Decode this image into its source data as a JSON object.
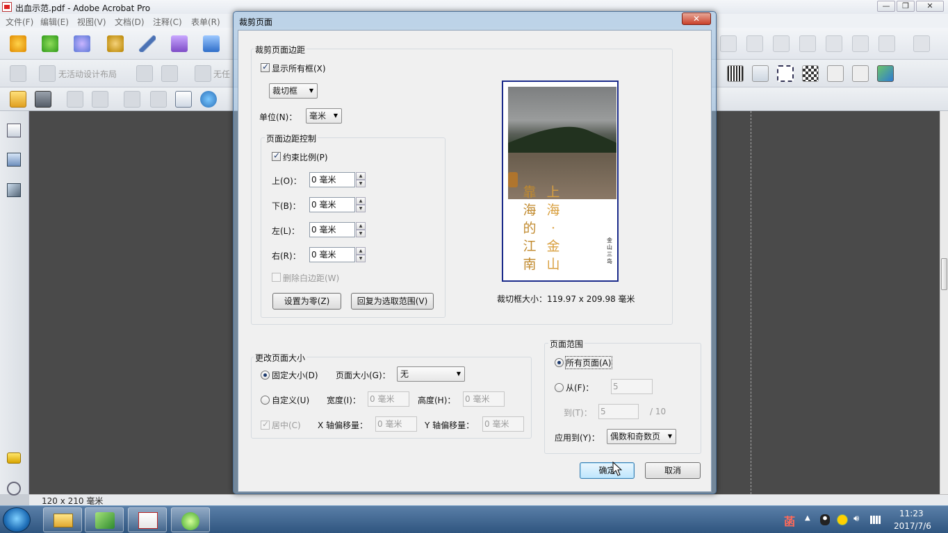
{
  "app": {
    "title": "出血示范.pdf - Adobe Acrobat Pro",
    "menus": [
      "文件(F)",
      "编辑(E)",
      "视图(V)",
      "文档(D)",
      "注释(C)",
      "表单(R)"
    ],
    "toolbar2": {
      "layout_label": "无活动设计布局",
      "task_label": "无任"
    },
    "status_page_size": "120 x 210 毫米",
    "window_controls": [
      "—",
      "❐",
      "✕"
    ]
  },
  "taskbar": {
    "time": "11:23",
    "date": "2017/7/6",
    "tray_ime": "菡"
  },
  "dialog": {
    "title": "裁剪页面",
    "close_label": "✕",
    "crop_margins": {
      "group_label": "裁剪页面边距",
      "show_all_boxes_label": "显示所有框(X)",
      "box_select_value": "裁切框",
      "unit_label": "单位(N)：",
      "unit_value": "毫米",
      "margin_control": {
        "group_label": "页面边距控制",
        "constrain_label": "约束比例(P)",
        "top_label": "上(O)：",
        "top_value": "0 毫米",
        "bottom_label": "下(B)：",
        "bottom_value": "0 毫米",
        "left_label": "左(L)：",
        "left_value": "0 毫米",
        "right_label": "右(R)：",
        "right_value": "0 毫米",
        "remove_white_label": "删除白边距(W)",
        "set_zero_label": "设置为零(Z)",
        "revert_label": "回复为选取范围(V)"
      },
      "preview_caption": "裁切框大小：119.97 x 209.98 毫米",
      "preview_poem_right": [
        "上",
        "海",
        "·",
        "金",
        "山"
      ],
      "preview_poem_left": [
        "靠",
        "海",
        "的",
        "江",
        "南"
      ],
      "preview_small_text": [
        "金",
        "山",
        "三",
        "岛"
      ]
    },
    "page_size": {
      "group_label": "更改页面大小",
      "fixed_label": "固定大小(D)",
      "page_size_label": "页面大小(G)：",
      "page_size_value": "无",
      "custom_label": "自定义(U)",
      "width_label": "宽度(I)：",
      "width_value": "0 毫米",
      "height_label": "高度(H)：",
      "height_value": "0 毫米",
      "center_label": "居中(C)",
      "x_offset_label": "X 轴偏移量：",
      "x_offset_value": "0 毫米",
      "y_offset_label": "Y 轴偏移量：",
      "y_offset_value": "0 毫米"
    },
    "page_range": {
      "group_label": "页面范围",
      "all_pages_label": "所有页面(A)",
      "from_label": "从(F)：",
      "from_value": "5",
      "to_label": "到(T)：",
      "to_value": "5",
      "total_label": "/ 10",
      "apply_label": "应用到(Y)：",
      "apply_value": "偶数和奇数页"
    },
    "ok_label": "确定",
    "cancel_label": "取消"
  }
}
